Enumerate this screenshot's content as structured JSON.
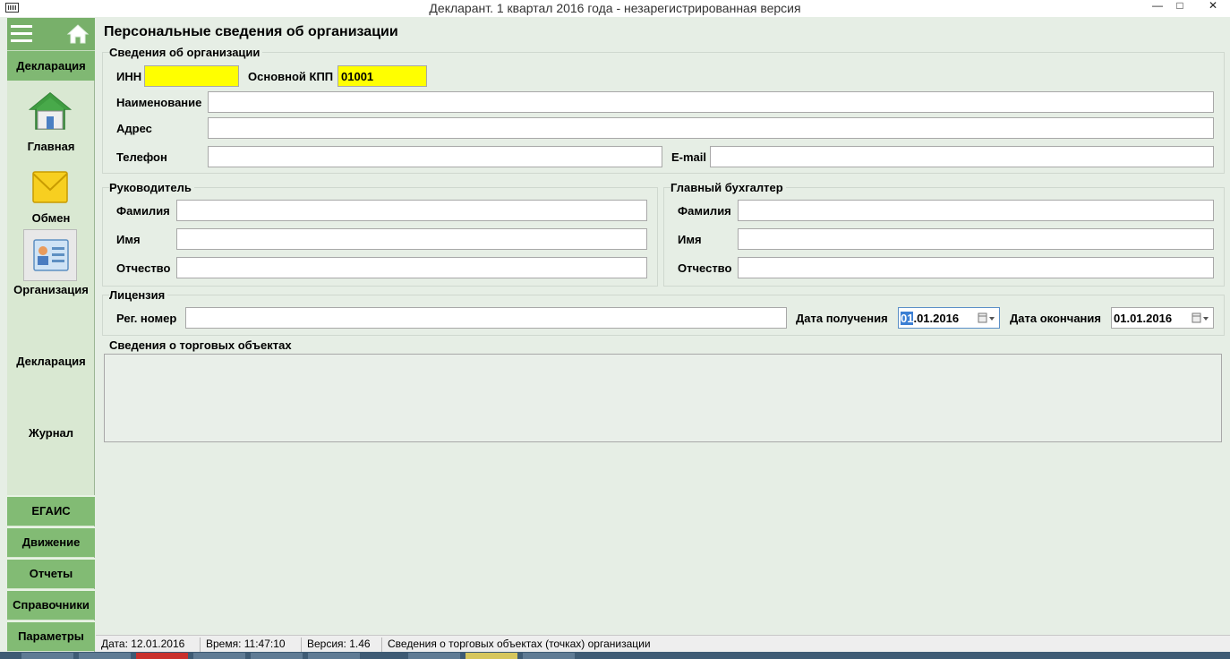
{
  "window": {
    "title": "Декларант.  1 квартал 2016 года - незарегистрированная версия"
  },
  "sidebar": {
    "header_section": "Декларация",
    "items": [
      {
        "label": "Главная",
        "icon": "house-icon"
      },
      {
        "label": "Обмен",
        "icon": "envelope-icon"
      },
      {
        "label": "Организация",
        "icon": "organization-card-icon"
      },
      {
        "label": "Декларация"
      },
      {
        "label": "Журнал"
      }
    ],
    "bottom_sections": [
      "ЕГАИС",
      "Движение",
      "Отчеты",
      "Справочники",
      "Параметры"
    ]
  },
  "page": {
    "title": "Персональные сведения об организации"
  },
  "org_info": {
    "group_label": "Сведения об организации",
    "inn_label": "ИНН",
    "inn_value": "",
    "kpp_label": "Основной КПП",
    "kpp_value": "01001",
    "name_label": "Наименование",
    "name_value": "",
    "address_label": "Адрес",
    "address_value": "",
    "phone_label": "Телефон",
    "phone_value": "",
    "email_label": "E-mail",
    "email_value": ""
  },
  "director": {
    "group_label": "Руководитель",
    "surname_label": "Фамилия",
    "name_label": "Имя",
    "patronymic_label": "Отчество"
  },
  "accountant": {
    "group_label": "Главный бухгалтер",
    "surname_label": "Фамилия",
    "name_label": "Имя",
    "patronymic_label": "Отчество"
  },
  "license": {
    "group_label": "Лицензия",
    "reg_label": "Рег. номер",
    "reg_value": "",
    "received_label": "Дата получения",
    "received_selected": "01",
    "received_rest": ".01.2016",
    "expiry_label": "Дата окончания",
    "expiry_value": "01.01.2016"
  },
  "trade_objects": {
    "group_label": "Сведения о торговых объектах"
  },
  "statusbar": {
    "date": "Дата: 12.01.2016",
    "time": "Время: 11:47:10",
    "version": "Версия: 1.46",
    "hint": "Сведения о торговых объектах (точках) организации"
  },
  "colors": {
    "sidebar_green": "#80b873",
    "highlight_yellow": "#ffff00",
    "panel_bg": "#e6eee5"
  }
}
